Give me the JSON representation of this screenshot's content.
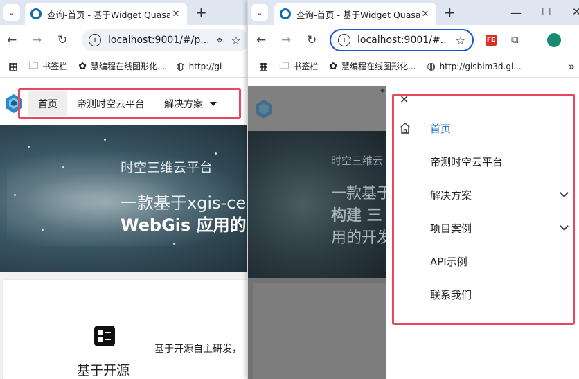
{
  "back_window": {
    "tab_title": "查询-首页 - 基于Widget Quasar",
    "url": "localhost:9001/#/p...",
    "bookmarks": [
      "书签栏",
      "慧编程在线图形化...",
      "http://gi"
    ],
    "nav": [
      "首页",
      "帝测时空云平台",
      "解决方案"
    ],
    "hero_line1": "时空三维云平台",
    "hero_line2": "一款基于xgis-ces",
    "hero_line3": "WebGis 应用的开",
    "feature_title": "基于开源",
    "feature_desc": "基于开源自主研发，"
  },
  "front_window": {
    "tab_title": "查询-首页 - 基于Widget Quasar",
    "url": "localhost:9001/#...",
    "bookmarks": [
      "书签栏",
      "慧编程在线图形化...",
      "http://gisbim3d.gl..."
    ],
    "more_bookmarks": "»",
    "hero_line1": "时空三维云",
    "hero_line2": "一款基于",
    "hero_line3": "构建 三",
    "hero_line4": "用的开发",
    "drawer_items": [
      "首页",
      "帝测时空云平台",
      "解决方案",
      "项目案例",
      "API示例",
      "联系我们"
    ]
  },
  "colors": {
    "highlight": "#e8485c",
    "active": "#1976d2",
    "tabbar": "#dfe6f1"
  }
}
